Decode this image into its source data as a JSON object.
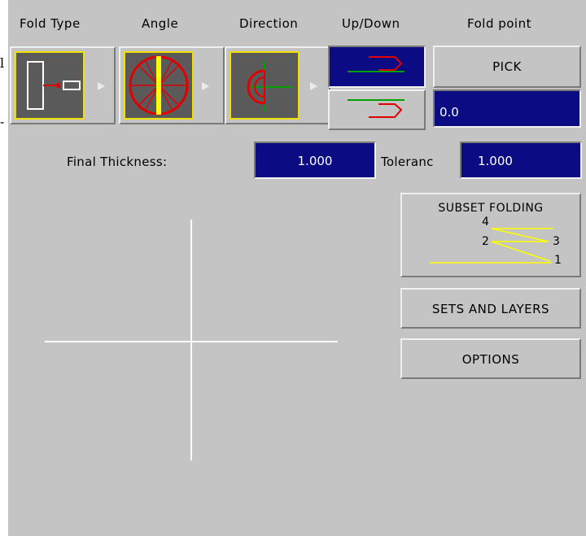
{
  "headers": {
    "fold_type": "Fold Type",
    "angle": "Angle",
    "direction": "Direction",
    "up_down": "Up/Down",
    "fold_point": "Fold point"
  },
  "fold_point": {
    "pick_label": "PICK",
    "value": "0.0"
  },
  "final_thickness": {
    "label": "Final Thickness:",
    "value": "1.000"
  },
  "tolerance": {
    "label": "Toleranc",
    "value": "1.000"
  },
  "subset_folding": {
    "label": "SUBSET FOLDING",
    "n1": "1",
    "n2": "2",
    "n3": "3",
    "n4": "4"
  },
  "sets_and_layers_label": "SETS AND LAYERS",
  "options_label": "OPTIONS",
  "edge_glyphs": {
    "top": "l",
    "bottom": "-"
  },
  "colors": {
    "panel": "#c4c4c4",
    "field": "#0b0b84",
    "icon_bg": "#5a5a5a",
    "icon_border": "#f0e000",
    "red": "#e00000",
    "green": "#00a000",
    "yellow": "#ffff00"
  },
  "icons": {
    "fold_type": "fold-type-icon",
    "angle": "angle-wheel-icon",
    "direction": "direction-icon",
    "up": "fold-up-icon",
    "down": "fold-down-icon"
  }
}
